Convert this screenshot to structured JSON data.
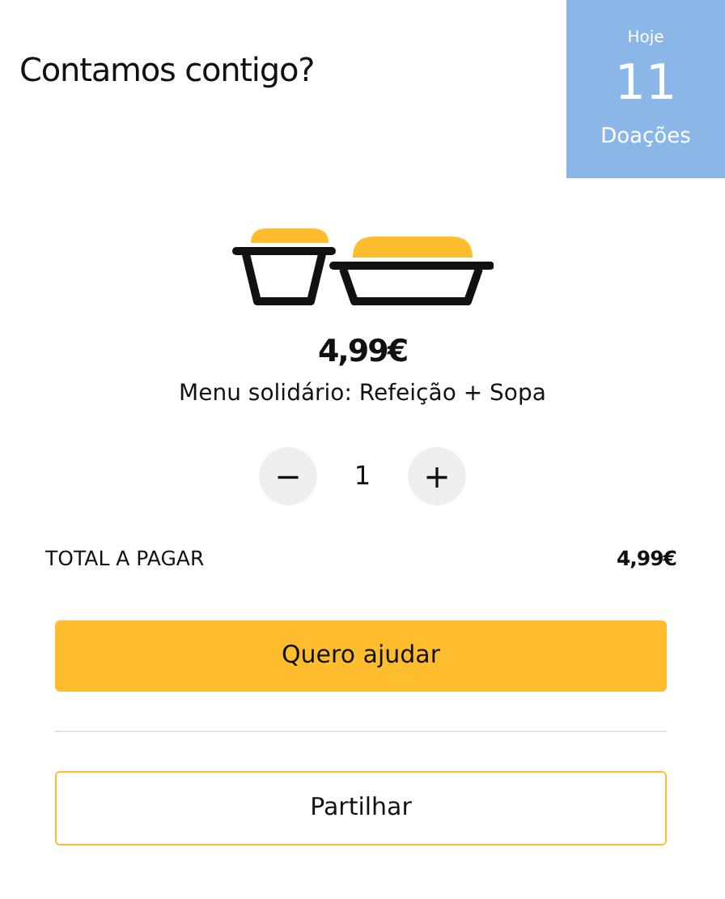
{
  "header": {
    "title": "Contamos contigo?"
  },
  "today_badge": {
    "label": "Hoje",
    "count": "11",
    "caption": "Doações"
  },
  "product": {
    "price": "4,99€",
    "description": "Menu solidário: Refeição + Sopa"
  },
  "quantity": {
    "decrease": "−",
    "value": "1",
    "increase": "+"
  },
  "total": {
    "label": "TOTAL A PAGAR",
    "amount": "4,99€"
  },
  "buttons": [
    {
      "label": "Quero ajudar",
      "kind": "primary"
    },
    {
      "kind": "divider"
    },
    {
      "label": "Partilhar",
      "kind": "outline"
    }
  ]
}
